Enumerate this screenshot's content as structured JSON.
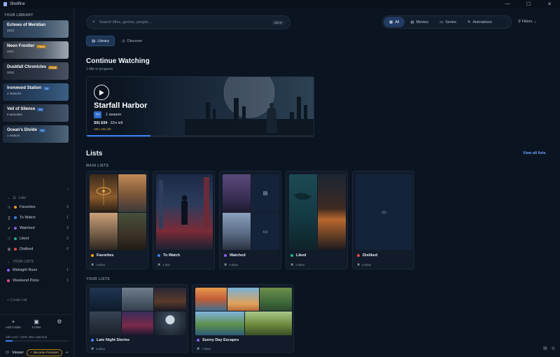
{
  "app": {
    "title": "Shelfine"
  },
  "window": {
    "minimize": "—",
    "maximize": "☐",
    "close": "✕"
  },
  "sidebar": {
    "heading": "YOUR LIBRARY",
    "library": [
      {
        "title": "Echoes of Meridian",
        "meta": "2023",
        "badge": ""
      },
      {
        "title": "Neon Frontier",
        "meta": "2021",
        "badge": "FILM"
      },
      {
        "title": "Duskfall Chronicles",
        "meta": "2022",
        "badge": "FILM"
      },
      {
        "title": "Ironwood Station",
        "meta": "2 seasons",
        "badge": "TV"
      },
      {
        "title": "Veil of Silence",
        "meta": "6 episodes",
        "badge": "TV"
      },
      {
        "title": "Ocean's Divide",
        "meta": "1 season",
        "badge": "TV"
      }
    ],
    "lists_header": "Lists",
    "lists": [
      {
        "label": "Favorites",
        "count": "3"
      },
      {
        "label": "To Watch",
        "count": "1"
      },
      {
        "label": "Watched",
        "count": "3"
      },
      {
        "label": "Liked",
        "count": "2"
      },
      {
        "label": "Disliked",
        "count": "0"
      }
    ],
    "your_lists_header": "YOUR LISTS",
    "your_lists": [
      {
        "label": "Midnight Runs",
        "count": "1"
      },
      {
        "label": "Weekend Picks",
        "count": "1"
      }
    ],
    "create_list": "Create List",
    "footer": {
      "add_folder": "Add Folder",
      "titles": "6 titles",
      "storage": "18h 14m / 168h 48m watched",
      "storage_fraction": 0.11,
      "user": "Viewer",
      "premium": "Become Premium"
    }
  },
  "search": {
    "placeholder": "Search titles, genres, people...",
    "shortcut": "Ctrl K"
  },
  "filters": {
    "options": [
      "All",
      "Movies",
      "Series",
      "Animations"
    ],
    "selected": "All",
    "button": "Filters"
  },
  "view_tabs": {
    "library": "Library",
    "discover": "Discover"
  },
  "continue": {
    "heading": "Continue Watching",
    "subtitle": "1 title in progress",
    "title": "Starfall Harbor",
    "badge": "TV",
    "type": "1 season",
    "episode": "S01 E04",
    "time_left": "32m left",
    "watched": "28m 19s left",
    "progress_fraction": 0.28
  },
  "lists": {
    "heading": "Lists",
    "view_all": "View all lists",
    "main_label": "MAIN LISTS",
    "main": [
      {
        "name": "Favorites",
        "count": "3 titles",
        "color": "#f59e0b"
      },
      {
        "name": "To Watch",
        "count": "1 title",
        "color": "#3b82f6"
      },
      {
        "name": "Watched",
        "count": "3 titles",
        "color": "#8b5cf6"
      },
      {
        "name": "Liked",
        "count": "2 titles",
        "color": "#10b981"
      },
      {
        "name": "Disliked",
        "count": "0 titles",
        "color": "#ef4444"
      }
    ],
    "your_label": "YOUR LISTS",
    "yours": [
      {
        "name": "Late Night Stories",
        "count": "8 titles",
        "color": "#3b82f6"
      },
      {
        "name": "Sunny Day Escapes",
        "count": "7 titles",
        "color": "#8b5cf6"
      }
    ]
  }
}
